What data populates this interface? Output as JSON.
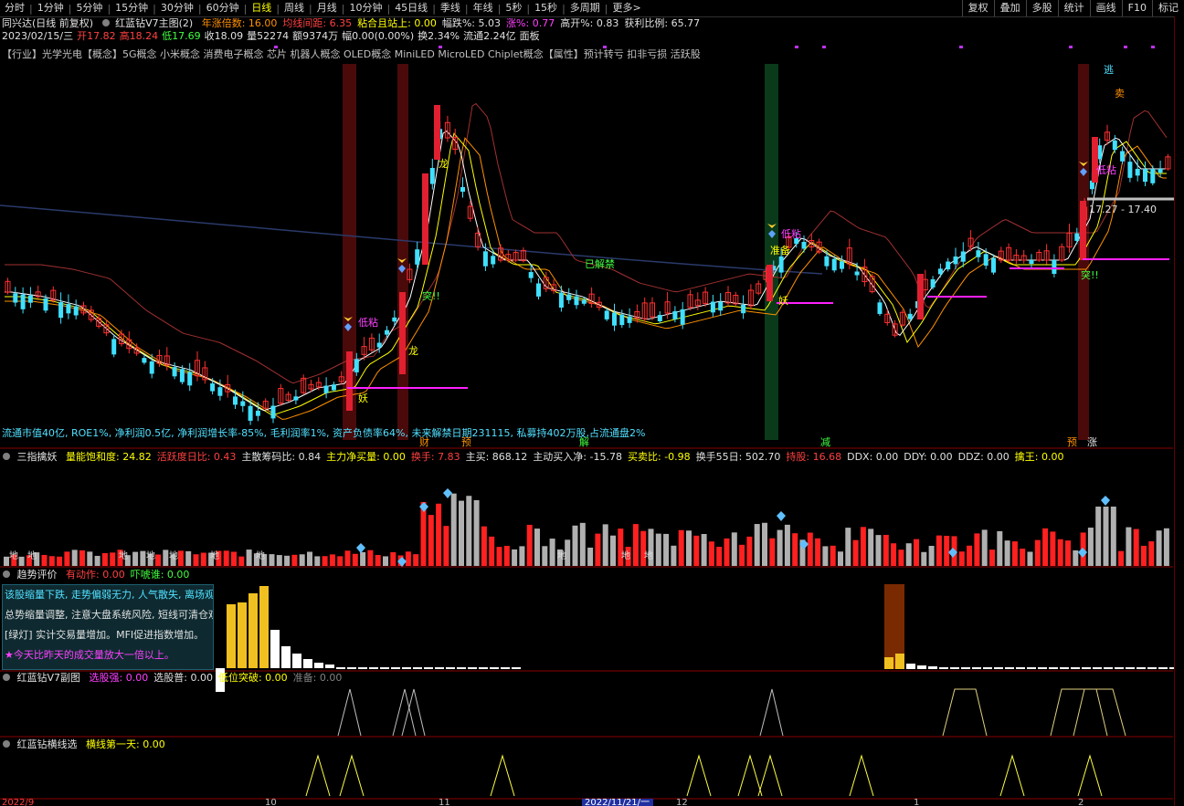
{
  "toolbar": {
    "tabs": [
      "分时",
      "1分钟",
      "5分钟",
      "15分钟",
      "30分钟",
      "60分钟",
      "日线",
      "周线",
      "月线",
      "10分钟",
      "45日线",
      "季线",
      "年线",
      "5秒",
      "15秒",
      "多周期",
      "更多>"
    ],
    "active": "日线",
    "right_buttons": [
      "复权",
      "叠加",
      "多股",
      "统计",
      "画线",
      "F10",
      "标记"
    ]
  },
  "header": {
    "title": "同兴达(日线 前复权)",
    "indicator": "红蓝钻V7主图(2)",
    "stats": [
      {
        "label": "年涨倍数:",
        "value": "16.00",
        "color": "#ff9000"
      },
      {
        "label": "均线间距:",
        "value": "6.35",
        "color": "#ff4040"
      },
      {
        "label": "粘合且站上:",
        "value": "0.00",
        "color": "#ffff00"
      },
      {
        "label": "幅跌%:",
        "value": "5.03",
        "color": "#e0e0e0"
      },
      {
        "label": "涨%:",
        "value": "0.77",
        "color": "#ff40ff"
      },
      {
        "label": "高开%:",
        "value": "0.83",
        "color": "#e0e0e0"
      },
      {
        "label": "获利比例:",
        "value": "65.77",
        "color": "#e0e0e0"
      }
    ],
    "ohlc": [
      {
        "text": "2023/02/15/三",
        "color": "#e0e0e0"
      },
      {
        "text": "开17.82",
        "color": "#ff4040"
      },
      {
        "text": "高18.24",
        "color": "#ff4040"
      },
      {
        "text": "低17.69",
        "color": "#40ff40"
      },
      {
        "text": "收18.09",
        "color": "#e0e0e0"
      },
      {
        "text": "量52274",
        "color": "#e0e0e0"
      },
      {
        "text": "额9374万",
        "color": "#e0e0e0"
      },
      {
        "text": "幅0.00(0.00%)",
        "color": "#e0e0e0"
      },
      {
        "text": "换2.34%",
        "color": "#e0e0e0"
      },
      {
        "text": "流通2.24亿",
        "color": "#e0e0e0"
      },
      {
        "text": "面板",
        "color": "#e0e0e0"
      }
    ],
    "concepts": "【行业】光学光电【概念】5G概念 小米概念 消费电子概念 芯片 机器人概念 OLED概念 MiniLED MicroLED Chiplet概念【属性】预计转亏 扣非亏损 活跃股",
    "fund_info": "流通市值40亿, ROE1%, 净利润0.5亿, 净利润增长率-85%, 毛利润率1%, 资产负债率64%, 未来解禁日期231115, 私募持402万股,占流通盘2%"
  },
  "chart_labels": {
    "low_drill": "低粘",
    "dragon": "龙",
    "demon": "妖",
    "breakout": "突!!",
    "unlocked": "已解禁",
    "prepare": "准备",
    "escape": "逃",
    "sell": "卖",
    "price_range": "17.27 - 17.40",
    "bottom_tags": [
      "财",
      "预",
      "解",
      "减",
      "预",
      "涨"
    ]
  },
  "panel1": {
    "name": "三指擒妖",
    "fields": [
      {
        "label": "量能饱和度:",
        "value": "24.82",
        "color": "#ffff00"
      },
      {
        "label": "活跃度日比:",
        "value": "0.43",
        "color": "#ff4040"
      },
      {
        "label": "主散筹码比:",
        "value": "0.84",
        "color": "#e0e0e0"
      },
      {
        "label": "主力净买量:",
        "value": "0.00",
        "color": "#ffff00"
      },
      {
        "label": "换手:",
        "value": "7.83",
        "color": "#ff4040"
      },
      {
        "label": "主买:",
        "value": "868.12",
        "color": "#e0e0e0"
      },
      {
        "label": "主动买入净:",
        "value": "-15.78",
        "color": "#e0e0e0"
      },
      {
        "label": "买卖比:",
        "value": "-0.98",
        "color": "#ffff00"
      },
      {
        "label": "换手55日:",
        "value": "502.70",
        "color": "#e0e0e0"
      },
      {
        "label": "持股:",
        "value": "16.68",
        "color": "#ff4040"
      },
      {
        "label": "DDX:",
        "value": "0.00",
        "color": "#e0e0e0"
      },
      {
        "label": "DDY:",
        "value": "0.00",
        "color": "#e0e0e0"
      },
      {
        "label": "DDZ:",
        "value": "0.00",
        "color": "#e0e0e0"
      },
      {
        "label": "擒王:",
        "value": "0.00",
        "color": "#ffff00"
      }
    ],
    "ground_label": "地"
  },
  "panel2": {
    "name": "趋势评价",
    "fields": [
      {
        "label": "有动作:",
        "value": "0.00",
        "color": "#ff4040"
      },
      {
        "label": "吓唬谁:",
        "value": "0.00",
        "color": "#40ff40"
      }
    ],
    "messages": [
      {
        "text": "该股缩量下跌, 走势偏弱无力, 人气散失, 离场观望。",
        "color": "#50e0ff"
      },
      {
        "text": "总势缩量调整, 注意大盘系统风险, 短线可清仓观望。",
        "color": "#e0e0e0"
      },
      {
        "text": "[绿灯] 实计交易量增加。MFI促进指数增加。",
        "color": "#e0e0e0"
      },
      {
        "text": "★今天比昨天的成交量放大一倍以上。",
        "color": "#ff40ff"
      }
    ]
  },
  "panel3": {
    "name": "红蓝钻V7副图",
    "fields": [
      {
        "label": "选股强:",
        "value": "0.00",
        "color": "#ff40ff"
      },
      {
        "label": "选股普:",
        "value": "0.00",
        "color": "#e0e0e0"
      },
      {
        "label": "低位突破:",
        "value": "0.00",
        "color": "#ffff00"
      },
      {
        "label": "准备:",
        "value": "0.00",
        "color": "#808080"
      }
    ]
  },
  "panel4": {
    "name": "红蓝钻横线选",
    "fields": [
      {
        "label": "横线第一天:",
        "value": "0.00",
        "color": "#ffff00"
      }
    ]
  },
  "xaxis": {
    "labels": [
      "2022/9",
      "10",
      "11",
      "2022/11/21/一",
      "12",
      "1",
      "2"
    ]
  },
  "colors": {
    "up": "#ff3030",
    "down": "#40e0ff",
    "ma5": "#ffffff",
    "ma10": "#ffff00",
    "ma20": "#ff9000",
    "ma60": "#203060",
    "magenta": "#ff20ff"
  }
}
